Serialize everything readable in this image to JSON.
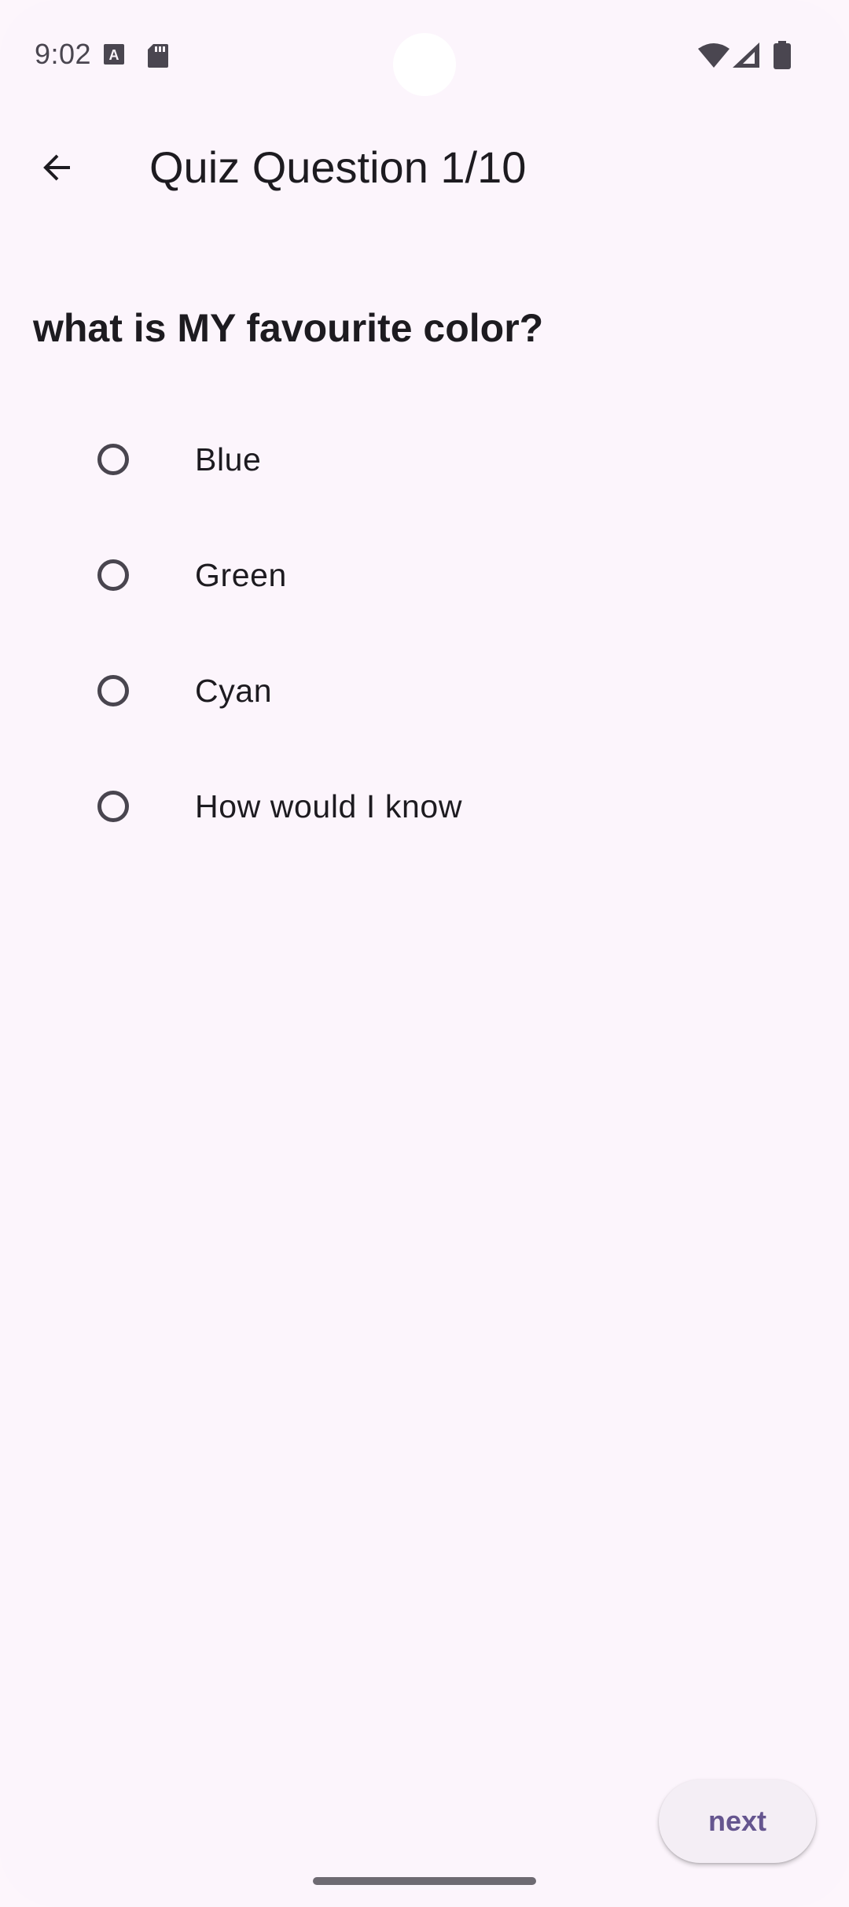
{
  "status_bar": {
    "time": "9:02",
    "left_icons": [
      "text-a-icon",
      "sd-card-icon"
    ],
    "right_icons": [
      "wifi-icon",
      "cell-signal-icon",
      "battery-icon"
    ]
  },
  "app_bar": {
    "back_icon": "arrow-back-icon",
    "title": "Quiz Question 1/10"
  },
  "quiz": {
    "question": "what is MY favourite color?",
    "options": [
      {
        "label": "Blue",
        "selected": false
      },
      {
        "label": "Green",
        "selected": false
      },
      {
        "label": "Cyan",
        "selected": false
      },
      {
        "label": "How would I know",
        "selected": false
      }
    ]
  },
  "footer": {
    "next_label": "next"
  },
  "colors": {
    "background": "#fcf5fc",
    "text": "#1d1b20",
    "accent": "#65558f",
    "radio_border": "#49454f"
  }
}
